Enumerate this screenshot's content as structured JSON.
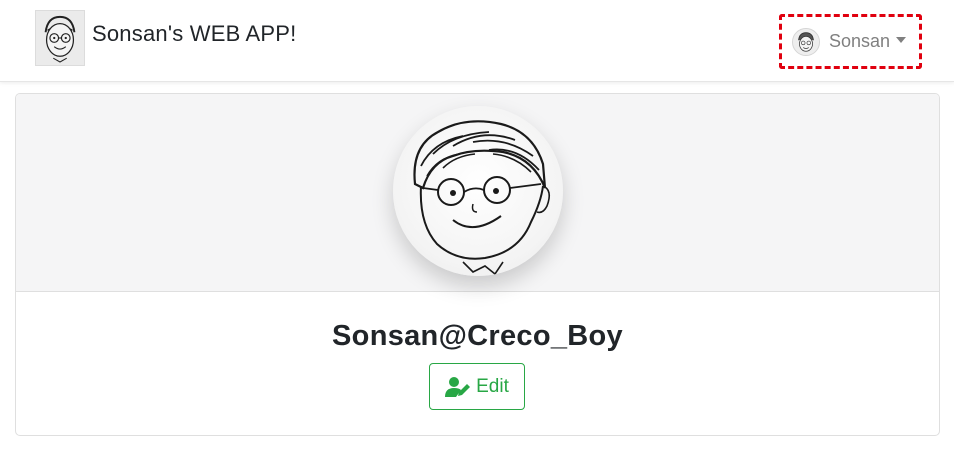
{
  "navbar": {
    "brand_title": "Sonsan's WEB APP!",
    "logo_icon": "face-drawing-icon"
  },
  "user_menu": {
    "name": "Sonsan",
    "avatar_icon": "face-drawing-icon",
    "caret_icon": "caret-down-icon"
  },
  "profile": {
    "photo_icon": "face-drawing-icon",
    "display_name": "Sonsan@Creco_Boy",
    "edit_label": "Edit",
    "edit_icon": "user-edit-icon"
  },
  "colors": {
    "accent_green": "#28a745",
    "highlight_red": "#e0000f",
    "header_bg": "#f5f5f6"
  }
}
